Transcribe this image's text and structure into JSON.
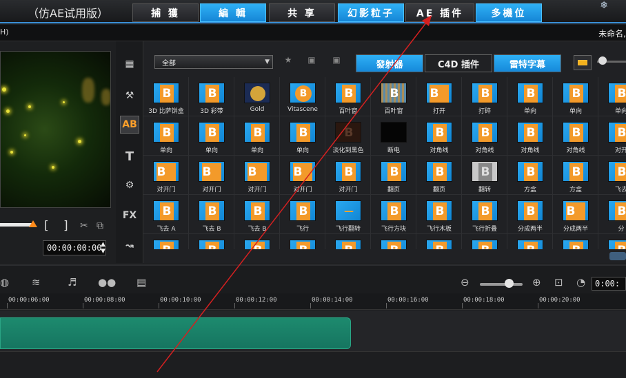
{
  "app": {
    "title": "（仿AE试用版）",
    "project_name": "未命名,",
    "menu_h": "H)"
  },
  "main_tabs": [
    {
      "label": "捕 獲",
      "style": "dark"
    },
    {
      "label": "編 輯",
      "style": "blue"
    },
    {
      "label": "共 享",
      "style": "dark"
    },
    {
      "label": "幻影粒子",
      "style": "blue"
    },
    {
      "label": "AE 插件",
      "style": "dark"
    },
    {
      "label": "多機位",
      "style": "blue"
    }
  ],
  "preview": {
    "timecode": "00:00:00:00"
  },
  "library": {
    "filter_value": "全部",
    "category_tabs": [
      {
        "label": "發射器",
        "style": "blue"
      },
      {
        "label": "C4D 插件",
        "style": "dark"
      },
      {
        "label": "雷特字幕",
        "style": "blue"
      }
    ],
    "items": [
      {
        "label": "3D 比萨饼盒",
        "thumb": "plain"
      },
      {
        "label": "3D 彩带",
        "thumb": "plain"
      },
      {
        "label": "Gold",
        "thumb": "gold"
      },
      {
        "label": "Vitascene",
        "thumb": "circle"
      },
      {
        "label": "百叶窗",
        "thumb": "plain"
      },
      {
        "label": "百叶窗",
        "thumb": "stripes"
      },
      {
        "label": "打开",
        "thumb": "split"
      },
      {
        "label": "打碎",
        "thumb": "plain"
      },
      {
        "label": "单向",
        "thumb": "plain"
      },
      {
        "label": "单向",
        "thumb": "plain"
      },
      {
        "label": "单向",
        "thumb": "plain"
      },
      {
        "label": "单向",
        "thumb": "plain"
      },
      {
        "label": "单向",
        "thumb": "plain"
      },
      {
        "label": "单向",
        "thumb": "plain"
      },
      {
        "label": "单向",
        "thumb": "plain"
      },
      {
        "label": "淡化到黑色",
        "thumb": "brown"
      },
      {
        "label": "断电",
        "thumb": "black"
      },
      {
        "label": "对角线",
        "thumb": "plain"
      },
      {
        "label": "对角线",
        "thumb": "plain"
      },
      {
        "label": "对角线",
        "thumb": "plain"
      },
      {
        "label": "对角线",
        "thumb": "plain"
      },
      {
        "label": "对开",
        "thumb": "plain"
      },
      {
        "label": "对开门",
        "thumb": "split"
      },
      {
        "label": "对开门",
        "thumb": "split"
      },
      {
        "label": "对开门",
        "thumb": "split"
      },
      {
        "label": "对开门",
        "thumb": "split"
      },
      {
        "label": "对开门",
        "thumb": "plain"
      },
      {
        "label": "翻页",
        "thumb": "plain"
      },
      {
        "label": "翻页",
        "thumb": "plain"
      },
      {
        "label": "翻转",
        "thumb": "gray"
      },
      {
        "label": "方盒",
        "thumb": "plain"
      },
      {
        "label": "方盒",
        "thumb": "plain"
      },
      {
        "label": "飞去",
        "thumb": "plain"
      },
      {
        "label": "飞去 A",
        "thumb": "plain"
      },
      {
        "label": "飞去 B",
        "thumb": "plain"
      },
      {
        "label": "飞去 B",
        "thumb": "plain"
      },
      {
        "label": "飞行",
        "thumb": "plain"
      },
      {
        "label": "飞行翻转",
        "thumb": "minus"
      },
      {
        "label": "飞行方块",
        "thumb": "plain"
      },
      {
        "label": "飞行木板",
        "thumb": "plain"
      },
      {
        "label": "飞行折叠",
        "thumb": "plain"
      },
      {
        "label": "分成两半",
        "thumb": "plain"
      },
      {
        "label": "分成两半",
        "thumb": "split"
      },
      {
        "label": "分",
        "thumb": "plain"
      },
      {
        "label": "",
        "thumb": "plain"
      },
      {
        "label": "",
        "thumb": "plain"
      },
      {
        "label": "",
        "thumb": "plain"
      },
      {
        "label": "",
        "thumb": "plain"
      },
      {
        "label": "",
        "thumb": "plain"
      },
      {
        "label": "",
        "thumb": "plain"
      },
      {
        "label": "",
        "thumb": "plain"
      },
      {
        "label": "",
        "thumb": "plain"
      },
      {
        "label": "",
        "thumb": "plain"
      },
      {
        "label": "",
        "thumb": "plain"
      },
      {
        "label": "",
        "thumb": "plain"
      }
    ]
  },
  "timeline": {
    "current_time": "0:00:",
    "ruler": [
      "00:00:06:00",
      "00:00:08:00",
      "00:00:10:00",
      "00:00:12:00",
      "00:00:14:00",
      "00:00:16:00",
      "00:00:18:00",
      "00:00:20:00"
    ]
  },
  "colors": {
    "accent_blue": "#1e9be8",
    "thumb_orange": "#f39a2a",
    "clip_green": "#1b8069",
    "annotation_red": "#d42020"
  }
}
